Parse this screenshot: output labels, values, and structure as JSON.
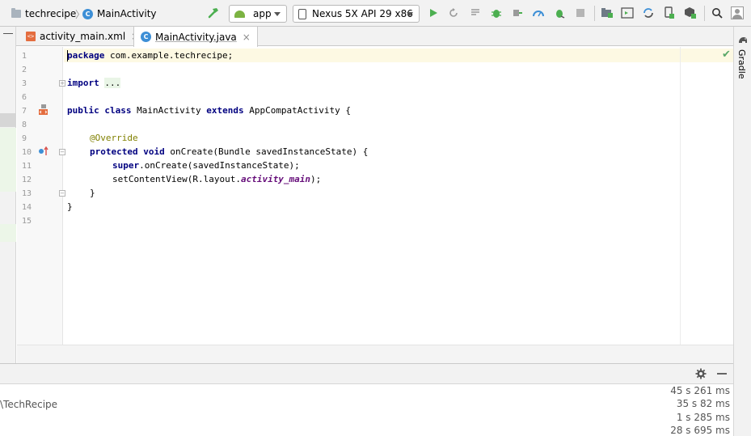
{
  "breadcrumb": {
    "project": "techrecipe",
    "file": "MainActivity"
  },
  "toolbar": {
    "run_config": "app",
    "device": "Nexus 5X API 29 x86"
  },
  "tabs": [
    {
      "label": "activity_main.xml",
      "close": "×"
    },
    {
      "label": "MainActivity.java",
      "close": "×"
    }
  ],
  "editor": {
    "line_numbers": [
      "1",
      "2",
      "3",
      "6",
      "7",
      "8",
      "9",
      "10",
      "11",
      "12",
      "13",
      "14",
      "15"
    ],
    "code": {
      "l1_kw": "package",
      "l1_rest": " com.example.techrecipe;",
      "l3_kw": "import",
      "l3_fold": "...",
      "l7_kw1": "public",
      "l7_kw2": "class",
      "l7_name": " MainActivity ",
      "l7_kw3": "extends",
      "l7_rest": " AppCompatActivity {",
      "l9_ann": "@Override",
      "l10_kw1": "protected",
      "l10_kw2": "void",
      "l10_rest": " onCreate(Bundle savedInstanceState) {",
      "l11_kw": "super",
      "l11_rest": ".onCreate(savedInstanceState);",
      "l12_pre": "setContentView(R.layout.",
      "l12_ital": "activity_main",
      "l12_post": ");",
      "l13": "}",
      "l14": "}"
    }
  },
  "right_stripe": {
    "gradle_label": "Gradle"
  },
  "bottom_panel": {
    "root_label": "\\TechRecipe",
    "timings": [
      "45 s 261 ms",
      "35 s 82 ms",
      "1 s 285 ms",
      "28 s 695 ms"
    ]
  },
  "colors": {
    "accent_green": "#59a869",
    "run_green": "#4caf50",
    "class_icon": "#3d8fd6",
    "xml_icon": "#e46d3f"
  }
}
